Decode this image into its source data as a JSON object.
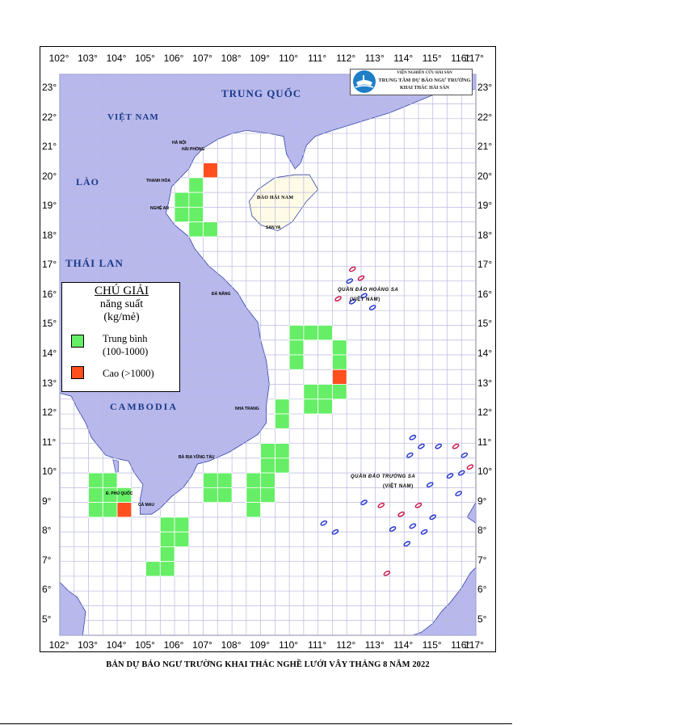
{
  "map": {
    "lon_labels": [
      "102°",
      "103°",
      "104°",
      "105°",
      "106°",
      "107°",
      "108°",
      "109°",
      "110°",
      "111°",
      "112°",
      "113°",
      "114°",
      "115°",
      "116°",
      "117°"
    ],
    "lat_labels": [
      "23°",
      "22°",
      "21°",
      "20°",
      "19°",
      "18°",
      "17°",
      "16°",
      "15°",
      "14°",
      "13°",
      "12°",
      "11°",
      "10°",
      "9°",
      "8°",
      "7°",
      "6°",
      "5°"
    ],
    "countries": {
      "vietnam": "VIỆT NAM",
      "china": "TRUNG QUỐC",
      "laos": "LÀO",
      "thailand": "THÁI LAN",
      "cambodia": "CAMBODIA",
      "hainan": "ĐẢO HẢI NAM"
    },
    "cities": {
      "hanoi": "HÀ NỘI",
      "haiphong": "HẢI PHÒNG",
      "thanhhoa": "THANH HÓA",
      "nghean": "NGHỆ AN",
      "danang": "ĐÀ NẴNG",
      "nhatrang": "NHA TRANG",
      "vungtau": "BÀ RỊA VŨNG TÀU",
      "phuquoc": "Đ. PHÚ QUỐC",
      "camau": "CÀ MAU",
      "sanya": "SAN YA"
    },
    "archipelagos": {
      "hoangsa": "QUẦN ĐẢO HOÀNG SA",
      "hoangsa_vn": "(VIỆT NAM)",
      "truongsa": "QUẦN ĐẢO TRƯỜNG SA",
      "truongsa_vn": "(VIỆT NAM)"
    },
    "colors": {
      "land": "#b8b8ec",
      "sea": "#ffffff",
      "grid": "#b8b8e0",
      "medium": "#66ee66",
      "high": "#ff4f1f",
      "label_blue": "#1a3a8a"
    },
    "cells_medium": [
      "106.5-107,19.5-20",
      "106-106.5,19-19.5",
      "106.5-107,19-19.5",
      "106-106.5,18.5-19",
      "106.5-107,18.5-19",
      "106.5-107,18-18.5",
      "107-107.5,18-18.5",
      "110-110.5,14.5-15",
      "110.5-111,14.5-15",
      "111-111.5,14.5-15",
      "110-110.5,14-14.5",
      "110-110.5,13.5-14",
      "111.5-112,14-14.5",
      "111.5-112,13.5-14",
      "110.5-111,12.5-13",
      "111-111.5,12.5-13",
      "111.5-112,12.5-13",
      "110.5-111,12-12.5",
      "111-111.5,12-12.5",
      "109.5-110,12-12.5",
      "109.5-110,11.5-12",
      "109.5-110,10.5-11",
      "109-109.5,10.5-11",
      "109.5-110,10-10.5",
      "109-109.5,10-10.5",
      "107-107.5,9.5-10",
      "107.5-108,9.5-10",
      "107-107.5,9-9.5",
      "107.5-108,9-9.5",
      "108.5-109,9.5-10",
      "109-109.5,9.5-10",
      "108.5-109,9-9.5",
      "109-109.5,9-9.5",
      "108.5-109,8.5-9",
      "103-103.5,9.5-10",
      "103.5-104,9.5-10",
      "104-104.5,9-9.5",
      "103-103.5,9-9.5",
      "103.5-104,9-9.5",
      "103-103.5,8.5-9",
      "103.5-104,8.5-9",
      "105.5-106,8-8.5",
      "106-106.5,8-8.5",
      "105.5-106,7.5-8",
      "106-106.5,7.5-8",
      "105.5-106,7-7.5",
      "105-105.5,6.5-7",
      "105.5-106,6.5-7"
    ],
    "cells_high": [
      "107-107.5,20-20.5",
      "111.5-112,13-13.5",
      "104-104.5,8.5-9"
    ]
  },
  "legend": {
    "title": "CHÚ GIẢI",
    "unit_line1": "năng suất",
    "unit_line2": "(kg/mẻ)",
    "items": [
      {
        "line1": "Trung bình",
        "line2": "(100-1000)"
      },
      {
        "line1": "Cao (>1000)",
        "line2": ""
      }
    ]
  },
  "logo": {
    "line1": "VIỆN NGHIÊN CỨU HẢI SẢN",
    "line2": "TRUNG TÂM DỰ BÁO NGƯ TRƯỜNG",
    "line3": "KHAI THÁC HẢI SẢN"
  },
  "caption": "BẢN DỰ BÁO NGƯ TRƯỜNG KHAI THÁC NGHỀ LƯỚI VÂY THÁNG 8 NĂM 2022"
}
